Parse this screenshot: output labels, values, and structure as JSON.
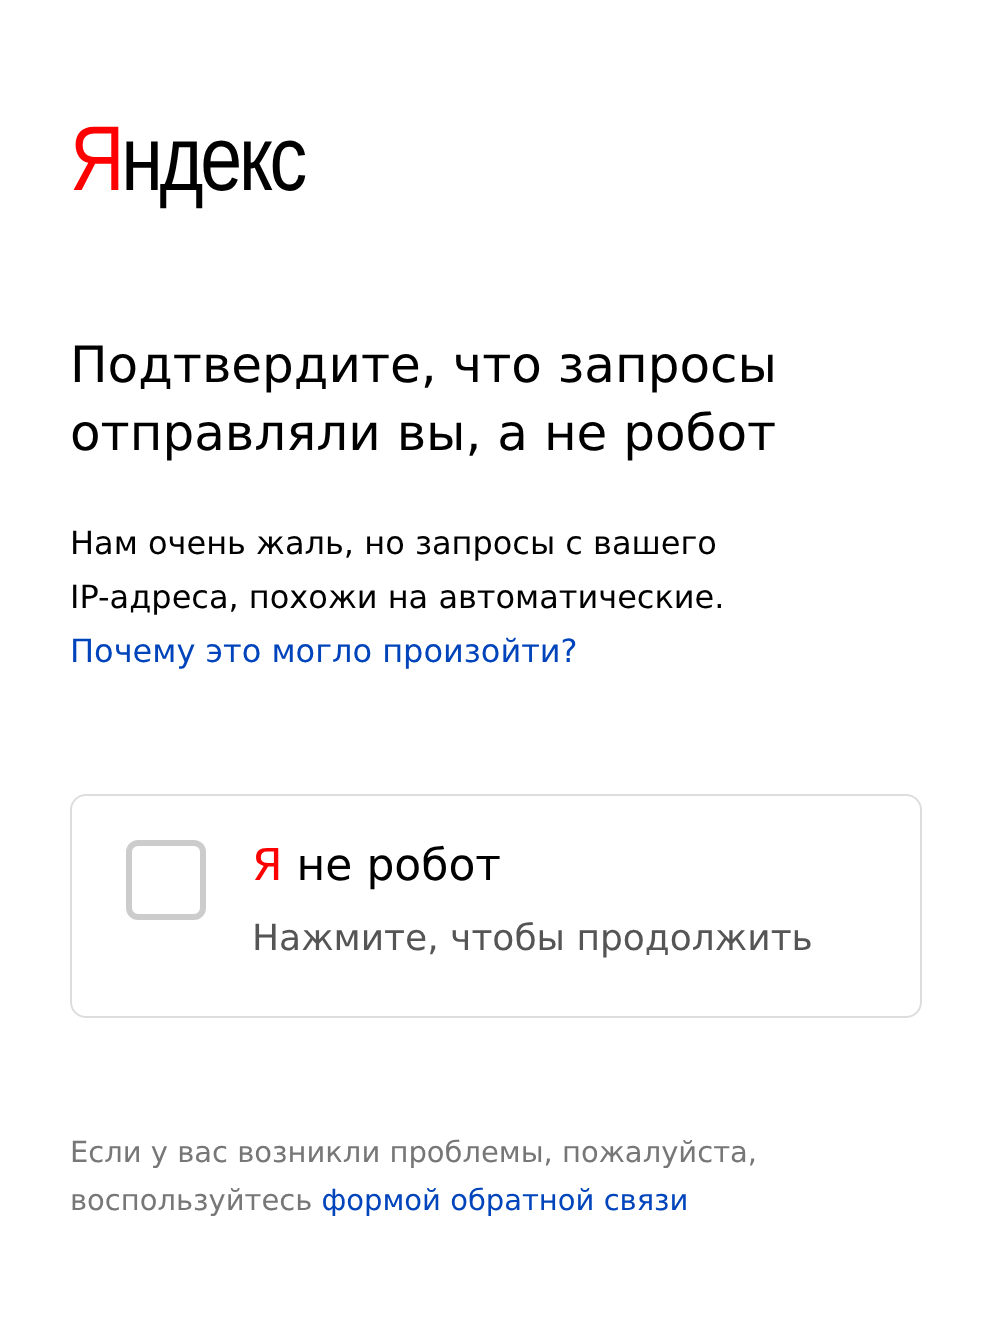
{
  "logo": [
    {
      "text": "Я",
      "color": "#ff0000"
    },
    {
      "text": "ндекс",
      "color": "#000000"
    }
  ],
  "heading": "Подтвердите, что запросы отправляли вы, а не робот",
  "message": [
    "Нам очень жаль, но запросы с вашего",
    "IP-адреса, похожи на автоматические."
  ],
  "why_link": "Почему это могло произойти?",
  "captcha": {
    "checked": false,
    "label": [
      {
        "text": "Я",
        "color": "#ff0000"
      },
      {
        "text": " не робот",
        "color": "#000000"
      }
    ],
    "hint": "Нажмите, чтобы продолжить"
  },
  "footer": {
    "text": "Если у вас возникли проблемы, пожалуйста, воспользуйтесь",
    "link": "формой обратной связи"
  }
}
